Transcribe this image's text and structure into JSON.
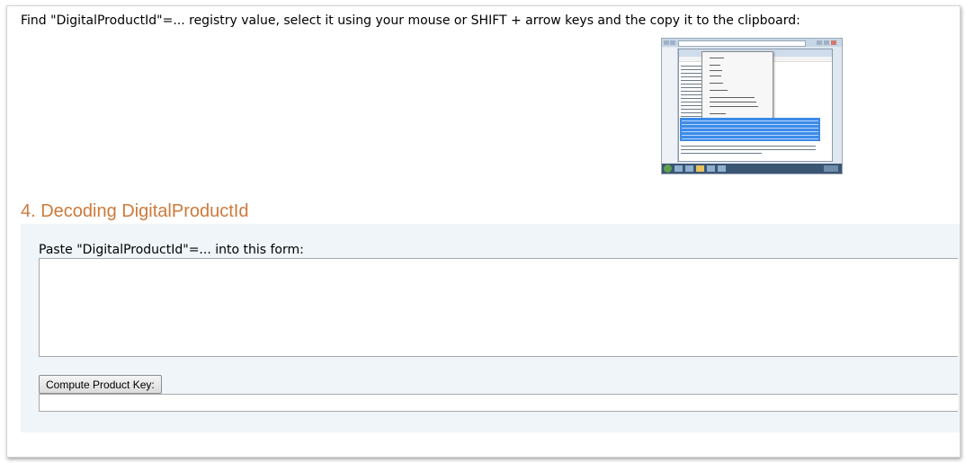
{
  "instructions": {
    "text": "Find \"DigitalProductId\"=... registry value, select it using your mouse or SHIFT + arrow keys and the copy it to the clipboard:"
  },
  "section": {
    "heading": "4. Decoding DigitalProductId"
  },
  "form": {
    "label": "Paste \"DigitalProductId\"=... into this form:",
    "input_value": "",
    "compute_button_label": "Compute Product Key:",
    "result_value": ""
  },
  "colors": {
    "heading": "#cc7a3c",
    "panel_background": "#eff5f8",
    "selection_highlight": "#3d8be8"
  },
  "icons": {
    "thumbnail": "registry-export-screenshot"
  }
}
